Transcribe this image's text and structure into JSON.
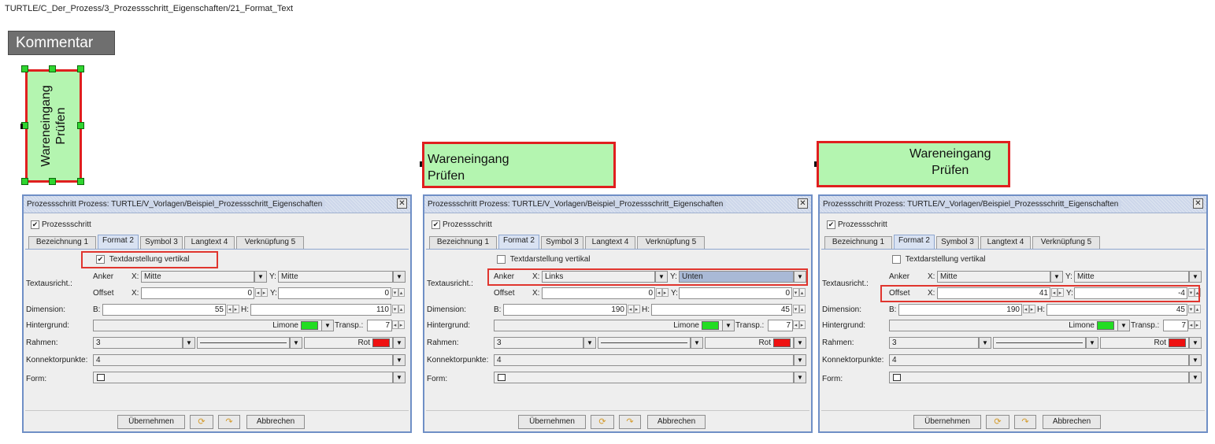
{
  "breadcrumb": "TURTLE/C_Der_Prozess/3_Prozessschritt_Eigenschaften/21_Format_Text",
  "kommentar": "Kommentar",
  "shape_text": {
    "line1": "Wareneingang",
    "line2": "Prüfen"
  },
  "colors": {
    "shape_fill": "#b4f5b0",
    "shape_border": "#e01f1f",
    "limone": "#22dd22",
    "rot": "#ee1111",
    "highlight": "#e0352e"
  },
  "dialog": {
    "title": "Prozessschritt Prozess: TURTLE/V_Vorlagen/Beispiel_Prozessschritt_Eigenschaften",
    "close_icon": "close-icon",
    "checkbox_label": "Prozessschritt",
    "tabs": [
      "Bezeichnung 1",
      "Format 2",
      "Symbol 3",
      "Langtext 4",
      "Verknüpfung 5"
    ],
    "vertical_label": "Textdarstellung vertikal",
    "textausricht": "Textausricht.:",
    "anker": "Anker",
    "offset": "Offset",
    "x": "X:",
    "y": "Y:",
    "dimension": "Dimension:",
    "b": "B:",
    "h": "H:",
    "hintergrund": "Hintergrund:",
    "transp": "Transp.:",
    "rahmen": "Rahmen:",
    "konnektor": "Konnektorpunkte:",
    "form": "Form:",
    "uebernehmen": "Übernehmen",
    "abbrechen": "Abbrechen",
    "limone": "Limone",
    "rot": "Rot",
    "rahmen_value": "3",
    "konnektor_value": "4",
    "transp_value": "7"
  },
  "dialogs": [
    {
      "vertical_checked": "✔",
      "anker_x": "Mitte",
      "anker_y": "Mitte",
      "offset_x": "0",
      "offset_y": "0",
      "b": "55",
      "h": "110"
    },
    {
      "vertical_checked": "",
      "anker_x": "Links",
      "anker_y": "Unten",
      "offset_x": "0",
      "offset_y": "0",
      "b": "190",
      "h": "45"
    },
    {
      "vertical_checked": "",
      "anker_x": "Mitte",
      "anker_y": "Mitte",
      "offset_x": "41",
      "offset_y": "-4",
      "b": "190",
      "h": "45"
    }
  ]
}
